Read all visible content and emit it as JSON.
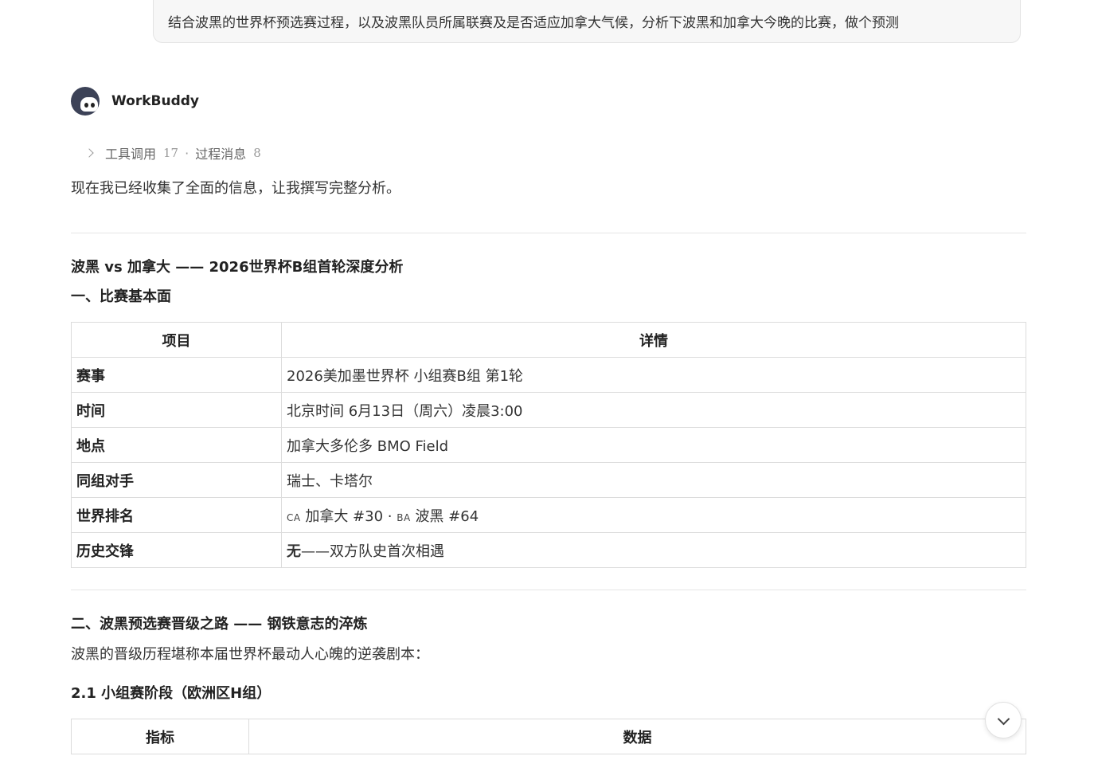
{
  "user_message": "结合波黑的世界杯预选赛过程，以及波黑队员所属联赛及是否适应加拿大气候，分析下波黑和加拿大今晚的比赛，做个预测",
  "assistant": {
    "name": "WorkBuddy",
    "process": {
      "tool_label": "工具调用",
      "tool_count": "17",
      "separator": "·",
      "msg_label": "过程消息",
      "msg_count": "8"
    },
    "intro": "现在我已经收集了全面的信息，让我撰写完整分析。"
  },
  "article": {
    "title": "波黑 vs 加拿大 —— 2026世界杯B组首轮深度分析",
    "section1_title": "一、比赛基本面",
    "table1": {
      "headers": [
        "项目",
        "详情"
      ],
      "rows": [
        {
          "key": "赛事",
          "value": "2026美加墨世界杯 小组赛B组 第1轮"
        },
        {
          "key": "时间",
          "value": "北京时间 6月13日（周六）凌晨3:00"
        },
        {
          "key": "地点",
          "value": "加拿大多伦多 BMO Field"
        },
        {
          "key": "同组对手",
          "value": "瑞士、卡塔尔"
        },
        {
          "key": "世界排名",
          "flag1": "CA",
          "value1": "加拿大 #30",
          "sep": "·",
          "flag2": "BA",
          "value2": "波黑 #64"
        },
        {
          "key": "历史交锋",
          "bold": "无",
          "value": "——双方队史首次相遇"
        }
      ]
    },
    "section2_title": "二、波黑预选赛晋级之路 —— 钢铁意志的淬炼",
    "section2_para": "波黑的晋级历程堪称本届世界杯最动人心魄的逆袭剧本：",
    "section21_title": "2.1 小组赛阶段（欧洲区H组）",
    "table2": {
      "headers": [
        "指标",
        "数据"
      ]
    }
  }
}
